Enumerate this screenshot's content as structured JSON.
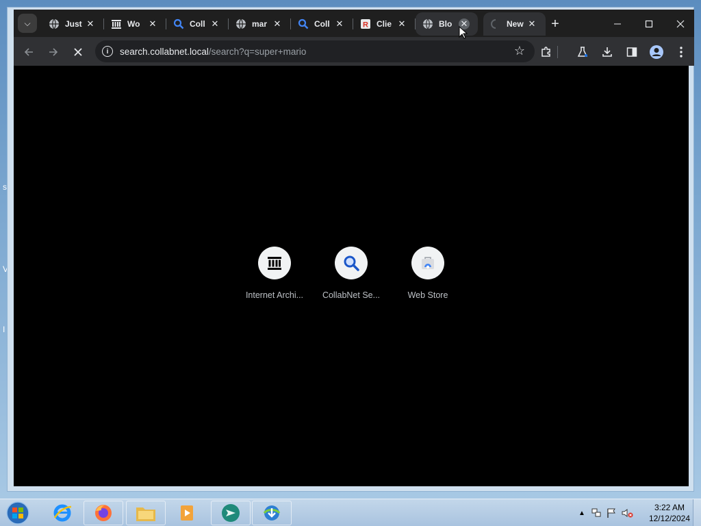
{
  "desktop": {
    "fragments": [
      "s",
      "V",
      "I"
    ]
  },
  "browser": {
    "tabs": [
      {
        "title": "Just",
        "icon": "globe-icon"
      },
      {
        "title": "Wo",
        "icon": "museum-icon"
      },
      {
        "title": "Coll",
        "icon": "search-icon"
      },
      {
        "title": "mar",
        "icon": "globe-icon"
      },
      {
        "title": "Coll",
        "icon": "search-icon"
      },
      {
        "title": "Clie",
        "icon": "r-logo-icon"
      },
      {
        "title": "Blo",
        "icon": "globe-icon"
      },
      {
        "title": "New",
        "icon": "none"
      }
    ],
    "address": {
      "host": "search.collabnet.local",
      "path": "/search?q=super+mario"
    }
  },
  "new_tab": {
    "shortcuts": [
      {
        "label": "Internet Archi..."
      },
      {
        "label": "CollabNet Se..."
      },
      {
        "label": "Web Store"
      }
    ]
  },
  "taskbar": {
    "time": "3:22 AM",
    "date": "12/12/2024"
  },
  "colors": {
    "chrome_dark": "#1f1f1f",
    "toolbar": "#303134",
    "omnibox": "#202124",
    "accent_blue": "#1a73e8",
    "taskbar": "#b6cde4"
  }
}
